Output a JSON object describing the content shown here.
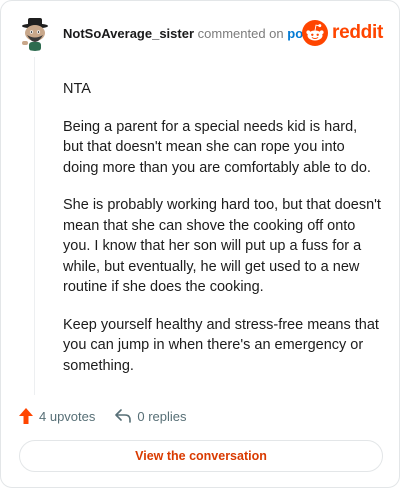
{
  "comment": {
    "username": "NotSoAverage_sister",
    "action_text": "commented on",
    "post_link": "post",
    "paragraphs": [
      "NTA",
      "Being a parent for a special needs kid is hard, but that doesn't mean she can rope you into doing more than you are comfortably able to do.",
      "She is probably working hard too, but that doesn't mean that she can shove the cooking off onto you. I know that her son will put up a fuss for a while, but eventually, he will get used to a new routine if she does the cooking.",
      "Keep yourself healthy and stress-free means that you can jump in when there's an emergency or something."
    ],
    "upvotes": "4 upvotes",
    "replies": "0 replies"
  },
  "brand": {
    "name": "reddit",
    "color": "#ff4500"
  },
  "cta": {
    "label": "View the conversation"
  },
  "colors": {
    "link": "#0079d3",
    "cta_text": "#d93a00",
    "upvote": "#ff4500"
  },
  "icons": {
    "avatar": "avatar-snoo-icon",
    "logo": "reddit-alien-icon",
    "upvote": "upvote-arrow-icon",
    "reply": "reply-arrow-icon"
  }
}
